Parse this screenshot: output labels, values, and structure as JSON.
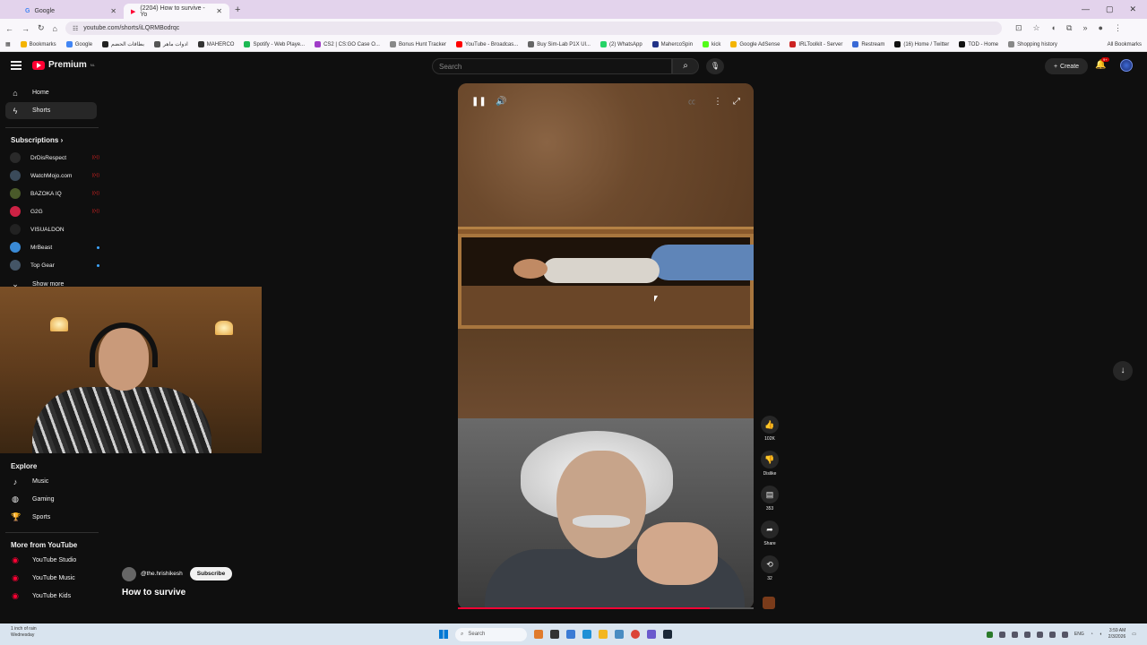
{
  "browser": {
    "tabs": [
      {
        "label": "Google",
        "active": false
      },
      {
        "label": "(2204) How to survive - Yo",
        "active": true
      }
    ],
    "url": "youtube.com/shorts/iLQRMBodrqc",
    "bookmarks": [
      "Bookmarks",
      "Google",
      "بطاقات الحضم",
      "ادوات ماهر",
      "MAHERCO",
      "Spotify - Web Playe...",
      "CS2 | CS:GO Case O...",
      "Bonus Hunt Tracker",
      "YouTube - Broadcas...",
      "Buy Sim-Lab P1X Ul...",
      "(2) WhatsApp",
      "MahercoSpin",
      "kick",
      "Google AdSense",
      "IRLToolkit - Server",
      "Restream",
      "(16) Home / Twitter",
      "TOD - Home",
      "Shopping history"
    ],
    "all_bookmarks": "All Bookmarks"
  },
  "header": {
    "logo": "Premium",
    "logo_sup": "NL",
    "search_placeholder": "Search",
    "create_label": "Create",
    "notif_count": "9+"
  },
  "sidebar": {
    "home": "Home",
    "shorts": "Shorts",
    "subscriptions_title": "Subscriptions",
    "subscriptions": [
      {
        "name": "DrDisRespect",
        "status": "live",
        "color": "#2a2a2a"
      },
      {
        "name": "WatchMojo.com",
        "status": "live",
        "color": "#3a4a5a"
      },
      {
        "name": "BAZOKA IQ",
        "status": "live",
        "color": "#4a5a2a"
      },
      {
        "name": "G2G",
        "status": "live",
        "color": "#cc2244"
      },
      {
        "name": "VISUALDON",
        "status": "none",
        "color": "#222"
      },
      {
        "name": "MrBeast",
        "status": "new",
        "color": "#3a8ad6"
      },
      {
        "name": "Top Gear",
        "status": "new",
        "color": "#445566"
      }
    ],
    "show_more": "Show more",
    "explore_title": "Explore",
    "explore": [
      "Music",
      "Gaming",
      "Sports"
    ],
    "more_title": "More from YouTube",
    "more": [
      "YouTube Studio",
      "YouTube Music",
      "YouTube Kids"
    ]
  },
  "short": {
    "channel": "@the.hrishikesh",
    "subscribe": "Subscribe",
    "title": "How to survive",
    "progress_percent": 85
  },
  "actions": {
    "likes": "102K",
    "dislike": "Dislike",
    "comments": "353",
    "share": "Share",
    "remix": "32"
  },
  "taskbar": {
    "weather_line1": "1 inch of rain",
    "weather_line2": "Wednesday",
    "search": "Search",
    "lang": "ENG",
    "time": "3:59 AM",
    "date": "2/3/2026"
  }
}
